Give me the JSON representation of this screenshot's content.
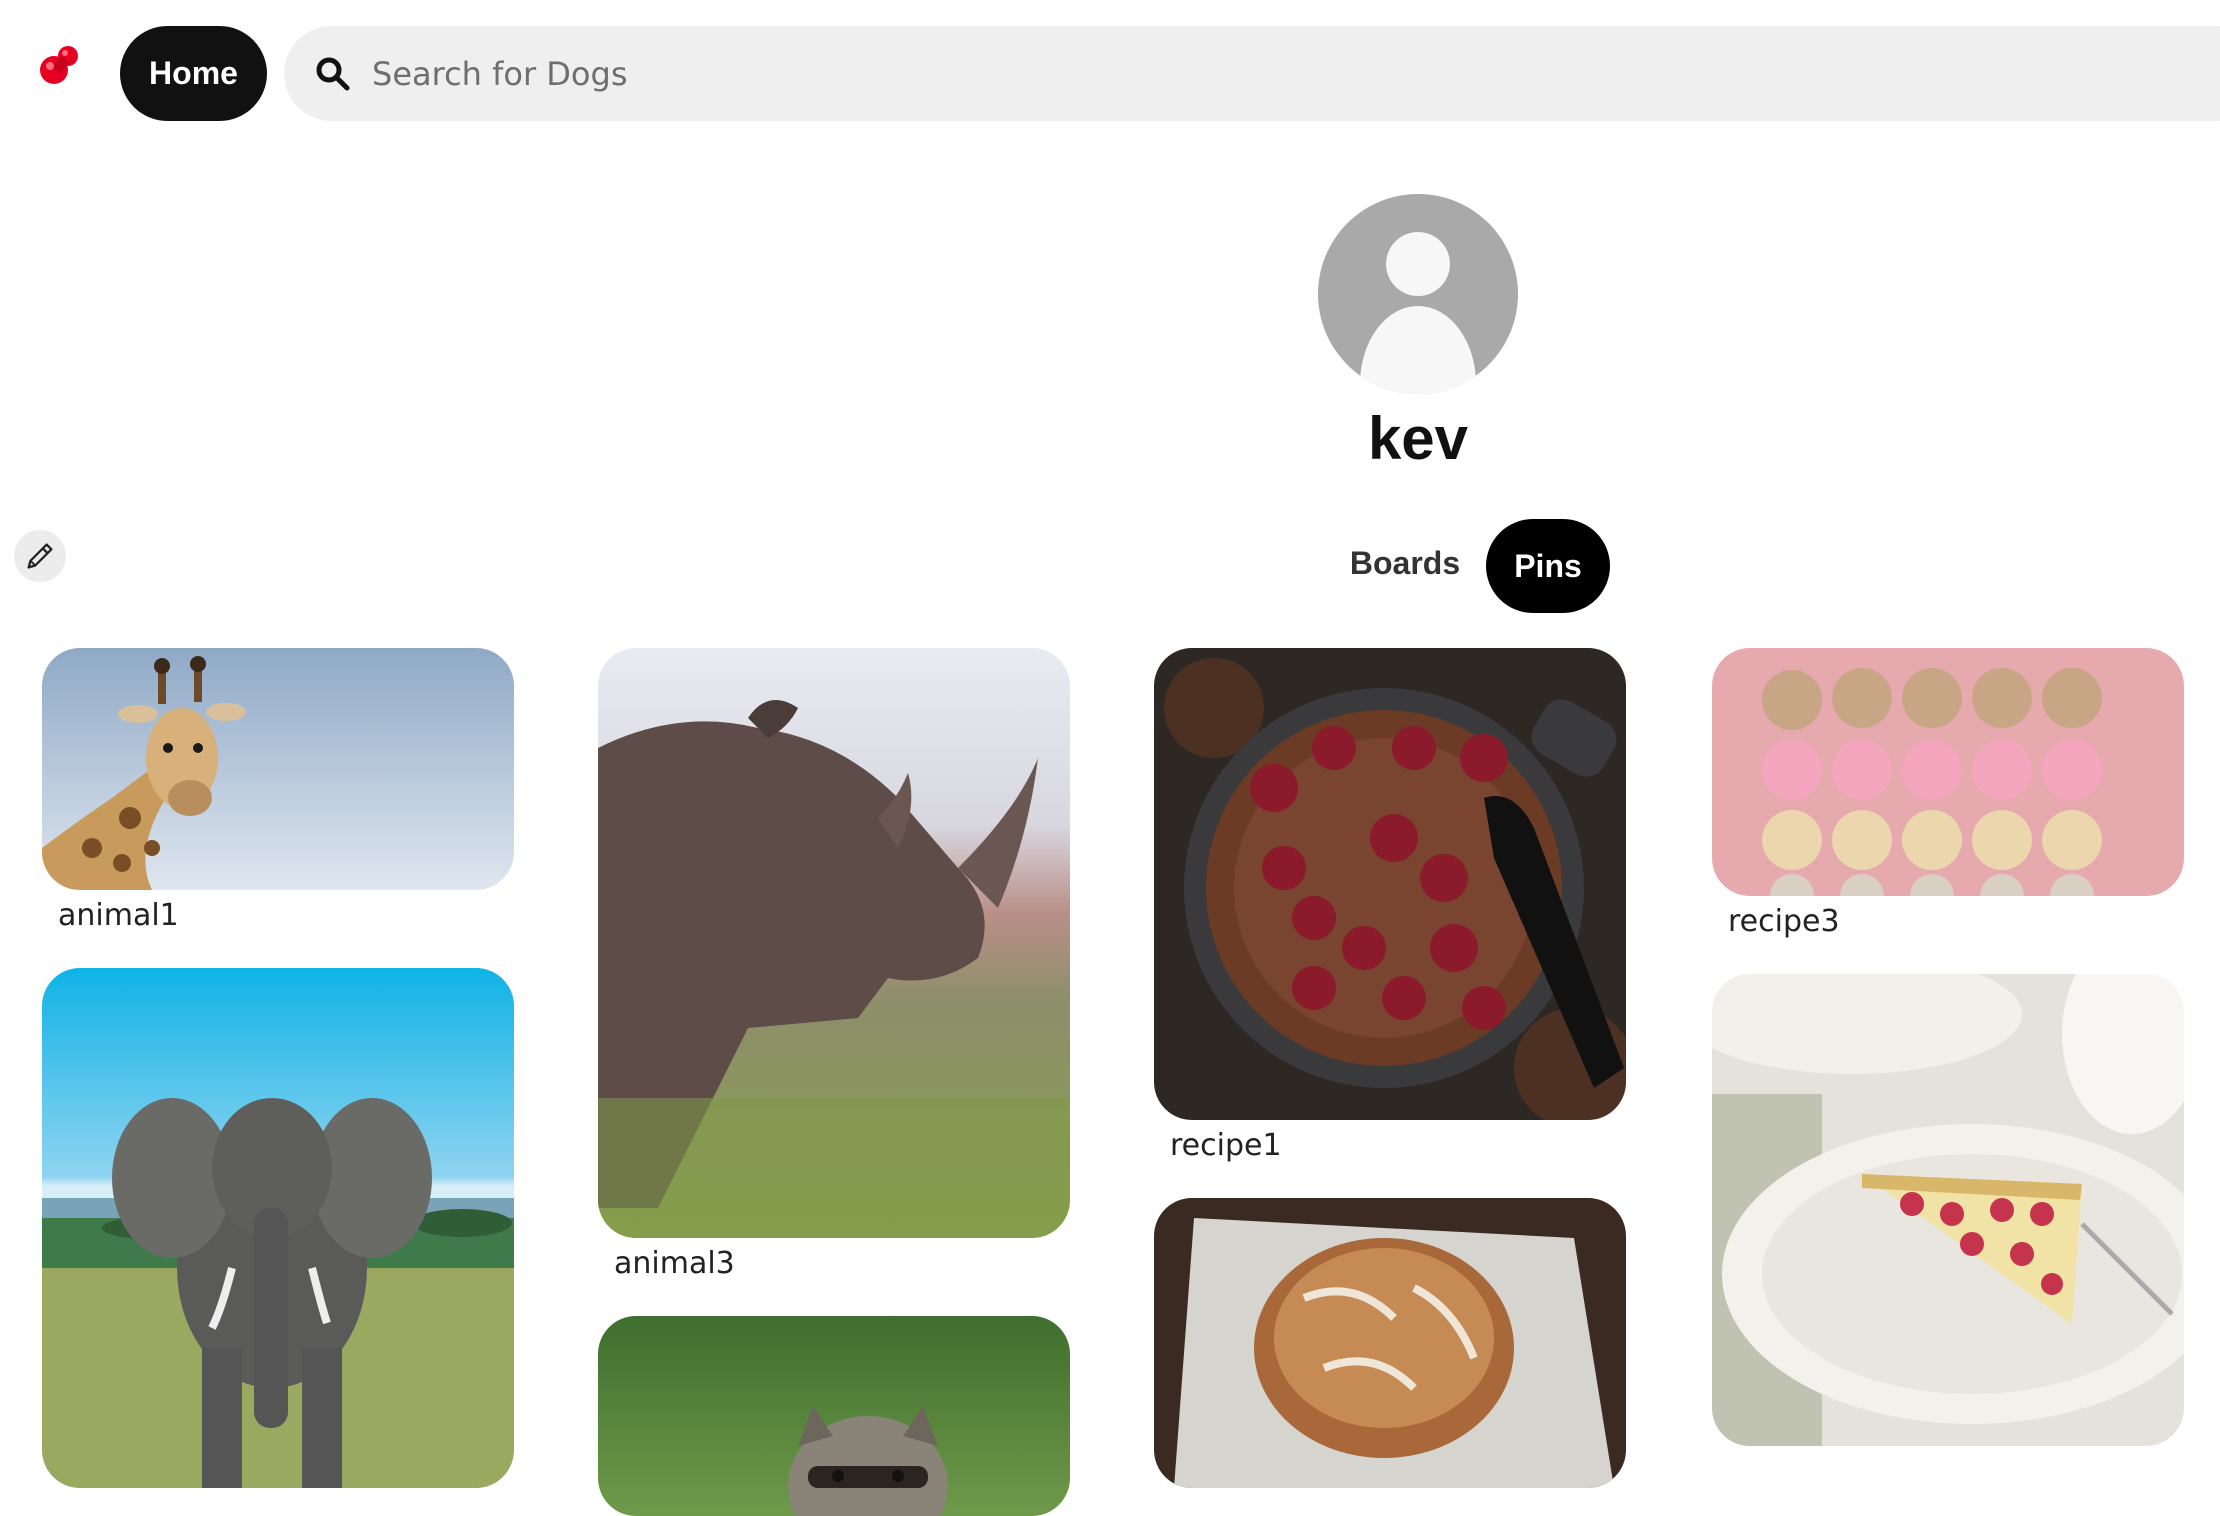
{
  "header": {
    "home_label": "Home",
    "search_placeholder": "Search for Dogs",
    "logo_icon": "pushpin-icon",
    "search_icon": "search-icon"
  },
  "profile": {
    "username": "kev",
    "avatar_icon": "user-avatar-icon",
    "edit_icon": "pencil-icon"
  },
  "tabs": {
    "boards_label": "Boards",
    "pins_label": "Pins",
    "active": "Pins"
  },
  "pins": [
    {
      "caption": "animal1",
      "subject": "giraffe"
    },
    {
      "caption": "animal3",
      "subject": "rhinoceros"
    },
    {
      "caption": "recipe1",
      "subject": "chocolate cherry cake"
    },
    {
      "caption": "recipe3",
      "subject": "macarons"
    },
    {
      "caption": "",
      "subject": "elephant"
    },
    {
      "caption": "",
      "subject": "raccoon"
    },
    {
      "caption": "",
      "subject": "bread loaf"
    },
    {
      "caption": "",
      "subject": "raspberry tart"
    }
  ],
  "colors": {
    "accent": "#111111",
    "logo_red": "#e60023",
    "search_bg": "#efefef",
    "avatar_bg": "#a9a9a9"
  }
}
